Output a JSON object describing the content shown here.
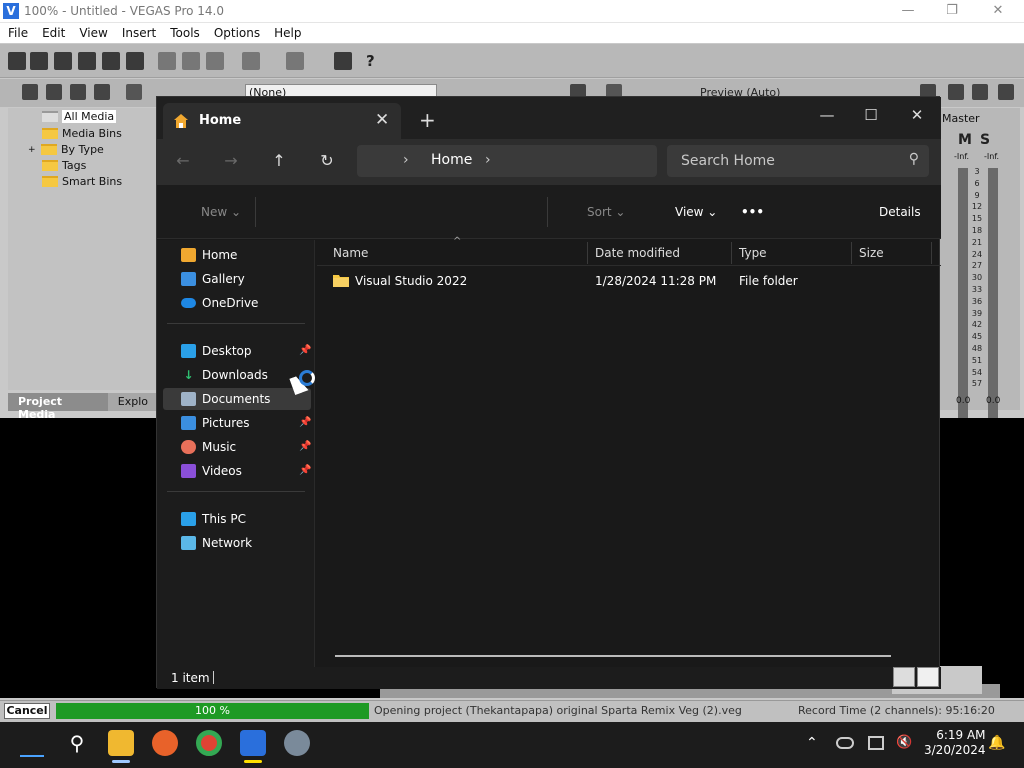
{
  "vegas": {
    "title": "100% - Untitled - VEGAS Pro 14.0",
    "menu": [
      "File",
      "Edit",
      "View",
      "Insert",
      "Tools",
      "Options",
      "Help"
    ],
    "preview_combo": "(None)",
    "preview_label": "Preview (Auto)",
    "project_media_tree": [
      "All Media",
      "Media Bins",
      "By Type",
      "Tags",
      "Smart Bins"
    ],
    "tabs": [
      "Project Media",
      "Explo"
    ],
    "master": {
      "label": "Master",
      "m": "M",
      "s": "S",
      "inf_left": "-Inf.",
      "inf_right": "-Inf.",
      "peak_left": "0.0",
      "peak_right": "0.0",
      "scale": [
        "3",
        "6",
        "9",
        "12",
        "15",
        "18",
        "21",
        "24",
        "27",
        "30",
        "33",
        "36",
        "39",
        "42",
        "45",
        "48",
        "51",
        "54",
        "57"
      ]
    },
    "status": {
      "cancel": "Cancel",
      "progress_text": "100 %",
      "progress": 1.0,
      "opening": "Opening project (Thekantapapa) original Sparta Remix Veg (2).veg",
      "record_time": "Record Time (2 channels): 95:16:20"
    }
  },
  "explorer": {
    "tab_title": "Home",
    "address": "Home",
    "search_placeholder": "Search Home",
    "toolbar": {
      "new": "New",
      "sort": "Sort",
      "view": "View",
      "more": "•••",
      "details": "Details"
    },
    "nav_top": [
      "Home",
      "Gallery",
      "OneDrive"
    ],
    "nav_pinned": [
      "Desktop",
      "Downloads",
      "Documents",
      "Pictures",
      "Music",
      "Videos"
    ],
    "nav_bottom": [
      "This PC",
      "Network"
    ],
    "columns": [
      "Name",
      "Date modified",
      "Type",
      "Size"
    ],
    "rows": [
      {
        "name": "Visual Studio 2022",
        "date": "1/28/2024 11:28 PM",
        "type": "File folder",
        "size": ""
      }
    ],
    "item_count": "1 item"
  },
  "taskbar": {
    "time": "6:19 AM",
    "date": "3/20/2024"
  },
  "colors": {
    "progress_green": "#1e9a24",
    "explorer_bg": "#191919",
    "folder_yellow": "#f5c842"
  }
}
